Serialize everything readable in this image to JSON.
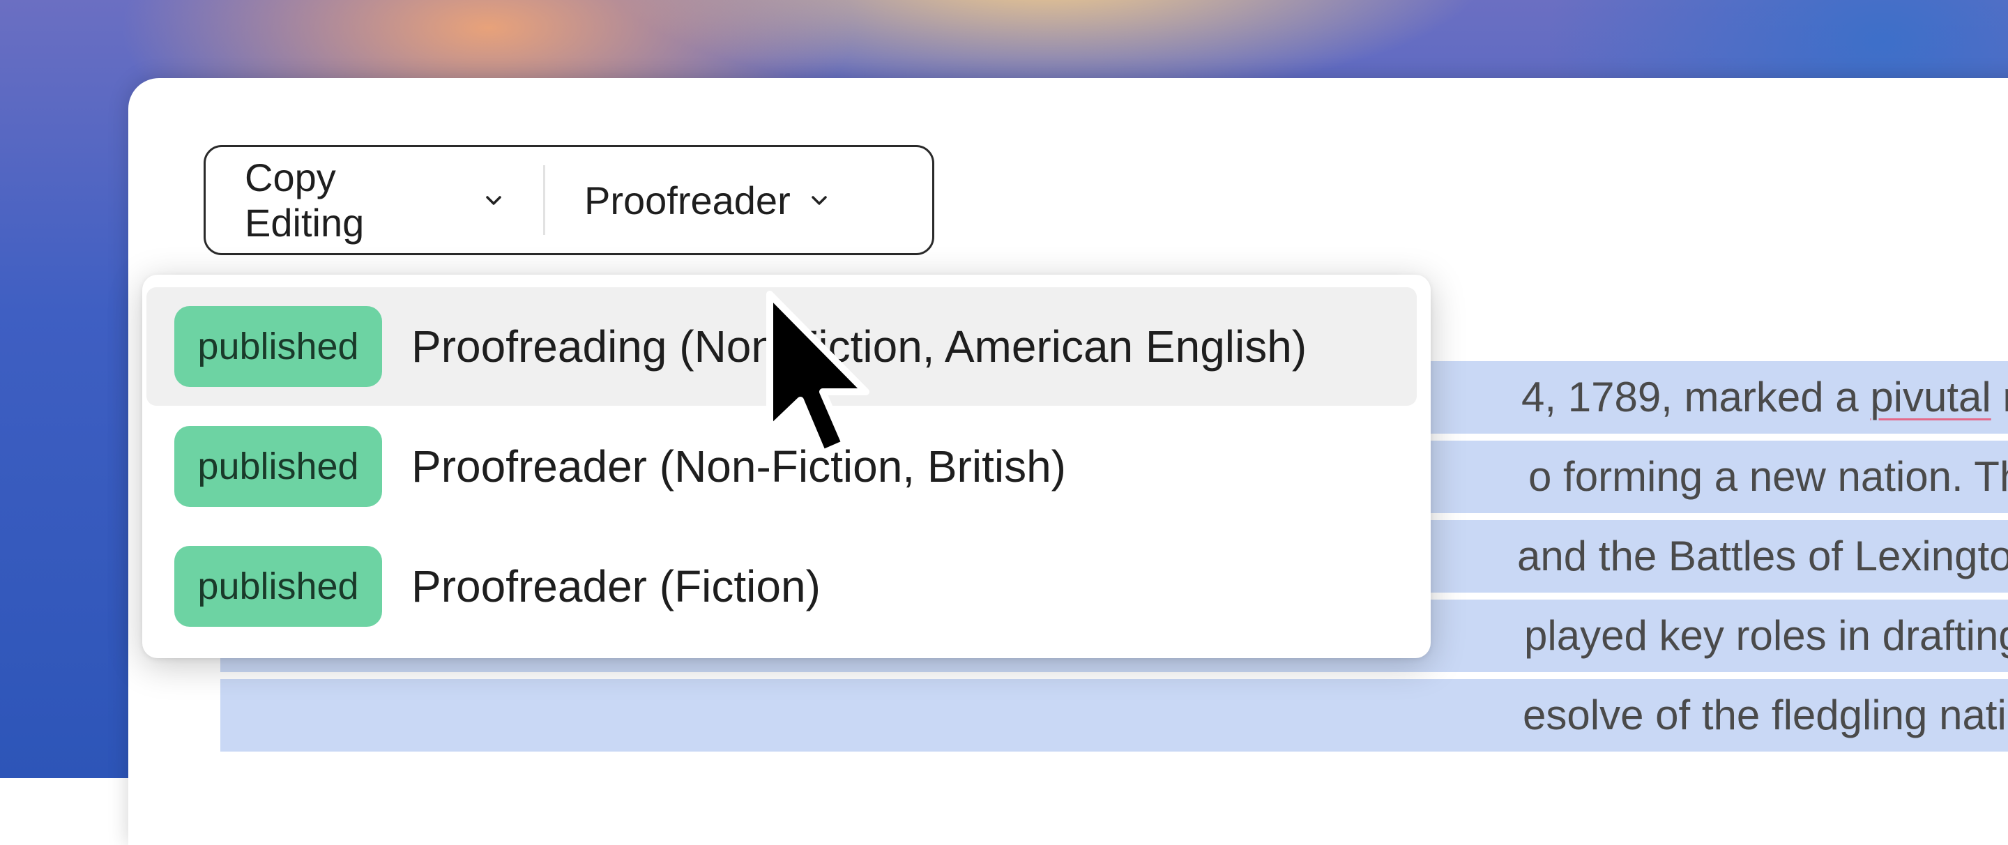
{
  "toolbar": {
    "copy_editing_label": "Copy Editing",
    "proofreader_label": "Proofreader"
  },
  "menu": {
    "items": [
      {
        "status": "published",
        "label": "Proofreading (Non-Fiction, American English)"
      },
      {
        "status": "published",
        "label": "Proofreader (Non-Fiction, British)"
      },
      {
        "status": "published",
        "label": "Proofreader (Fiction)"
      }
    ]
  },
  "document": {
    "line1_pre": "4, 1789, marked a ",
    "line1_misspelled": "pivutal",
    "line1_post": " m",
    "line2": "o forming a new nation. Thi",
    "line3": "and the Battles of Lexingto",
    "line4": "played key roles in drafting",
    "line5": "esolve of the fledgling natio"
  },
  "colors": {
    "badge": "#6dd3a3",
    "selection": "#c9d8f5",
    "spell_underline": "#e36a8a"
  },
  "icons": {
    "dropdown": "chevron-down-icon",
    "pointer": "mouse-cursor-icon"
  }
}
